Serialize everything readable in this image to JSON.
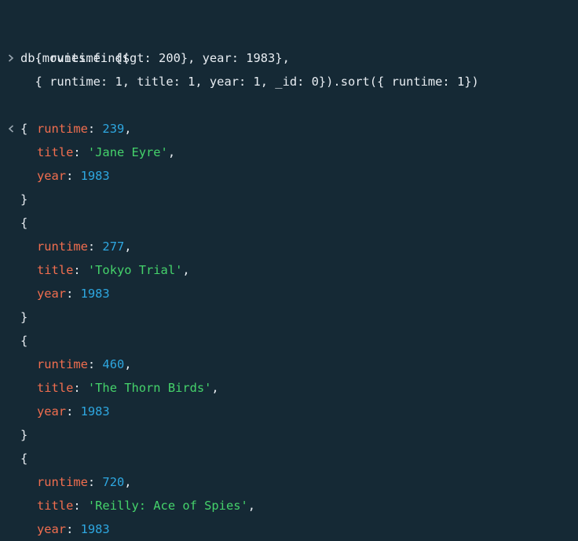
{
  "colors": {
    "background": "#152935",
    "text": "#e8edf2",
    "key": "#f26e4f",
    "number": "#2ea7e0",
    "string": "#45d36b",
    "prompt_glyph": "#9aa7b1"
  },
  "icons": {
    "input_prompt": "chevron-right-icon",
    "output_prompt": "chevron-left-icon"
  },
  "input": {
    "line1": "db.movies.find(",
    "line2": "  { runtime: {$gt: 200}, year: 1983},",
    "line3": "  { runtime: 1, title: 1, year: 1, _id: 0}).sort({ runtime: 1})"
  },
  "syntax": {
    "open_brace": "{",
    "close_brace": "}",
    "colon": ": ",
    "comma": ",",
    "runtime_key": "runtime",
    "title_key": "title",
    "year_key": "year"
  },
  "results": [
    {
      "runtime": "239",
      "title": "'Jane Eyre'",
      "year": "1983"
    },
    {
      "runtime": "277",
      "title": "'Tokyo Trial'",
      "year": "1983"
    },
    {
      "runtime": "460",
      "title": "'The Thorn Birds'",
      "year": "1983"
    },
    {
      "runtime": "720",
      "title": "'Reilly: Ace of Spies'",
      "year": "1983"
    }
  ]
}
